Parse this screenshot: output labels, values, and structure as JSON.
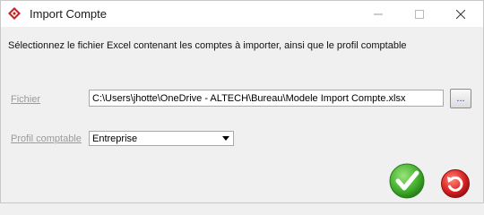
{
  "window": {
    "title": "Import Compte",
    "icons": {
      "app": "diamond-app-icon",
      "minimize": "minimize-icon",
      "maximize": "maximize-icon",
      "close": "close-icon"
    }
  },
  "form": {
    "instruction": "Sélectionnez le fichier Excel contenant les comptes à importer, ainsi que le profil comptable",
    "file_label": "Fichier",
    "file_value": "C:\\Users\\jhotte\\OneDrive - ALTECH\\Bureau\\Modele Import Compte.xlsx",
    "browse_label": "...",
    "profile_label": "Profil comptable",
    "profile_selected": "Entreprise"
  },
  "actions": {
    "ok_icon": "green-check-icon",
    "cancel_icon": "red-undo-icon"
  },
  "colors": {
    "ok": "#3fae2a",
    "cancel": "#d8201f",
    "app_icon": "#c0282c"
  }
}
